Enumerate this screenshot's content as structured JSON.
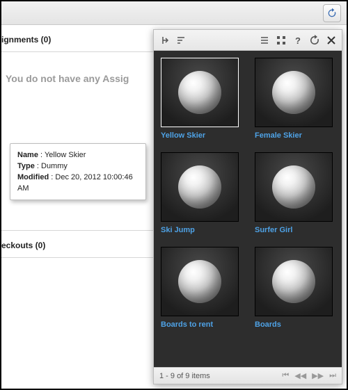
{
  "topbar": {},
  "left": {
    "assignments_header": "ignments (0)",
    "empty_msg": "You do not have any Assig",
    "checkouts_header": "eckouts (0)"
  },
  "tooltip": {
    "name_label": "Name",
    "name_value": "Yellow Skier",
    "type_label": "Type",
    "type_value": "Dummy",
    "modified_label": "Modified",
    "modified_value": "Dec 20, 2012 10:00:46 AM"
  },
  "panel": {
    "items": [
      {
        "label": "Yellow Skier",
        "selected": true
      },
      {
        "label": "Female Skier",
        "selected": false
      },
      {
        "label": "Ski Jump",
        "selected": false
      },
      {
        "label": "Surfer Girl",
        "selected": false
      },
      {
        "label": "Boards to rent",
        "selected": false
      },
      {
        "label": "Boards",
        "selected": false
      }
    ],
    "footer_status": "1 - 9 of 9 items",
    "pager": {
      "first": "⏮",
      "prev": "◀◀",
      "next": "▶▶",
      "last": "⏭"
    }
  }
}
